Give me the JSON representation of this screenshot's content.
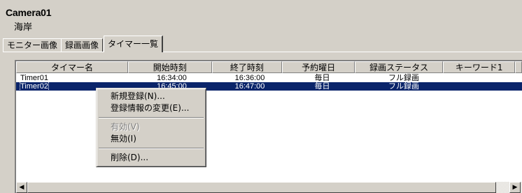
{
  "camera": {
    "name": "Camera01",
    "location": "海岸"
  },
  "tabs": [
    {
      "label": "モニター画像"
    },
    {
      "label": "録画画像"
    },
    {
      "label": "タイマー一覧"
    }
  ],
  "list": {
    "columns": [
      "タイマー名",
      "開始時刻",
      "終了時刻",
      "予約曜日",
      "録画ステータス",
      "キーワード1"
    ],
    "rows": [
      {
        "name": "Timer01",
        "start": "16:34:00",
        "end": "16:36:00",
        "day": "毎日",
        "status": "フル録画",
        "keyword": ""
      },
      {
        "name": "Timer02",
        "start": "16:45:00",
        "end": "16:47:00",
        "day": "毎日",
        "status": "フル録画",
        "keyword": ""
      }
    ]
  },
  "context_menu": {
    "new": "新規登録(N)...",
    "change": "登録情報の変更(E)...",
    "enable": "有効(V)",
    "disable": "無効(I)",
    "delete": "削除(D)..."
  },
  "scrollbar": {
    "left_arrow": "◀",
    "right_arrow": "▶"
  },
  "colors": {
    "selection": "#0a246a",
    "face": "#d4d0c8"
  }
}
